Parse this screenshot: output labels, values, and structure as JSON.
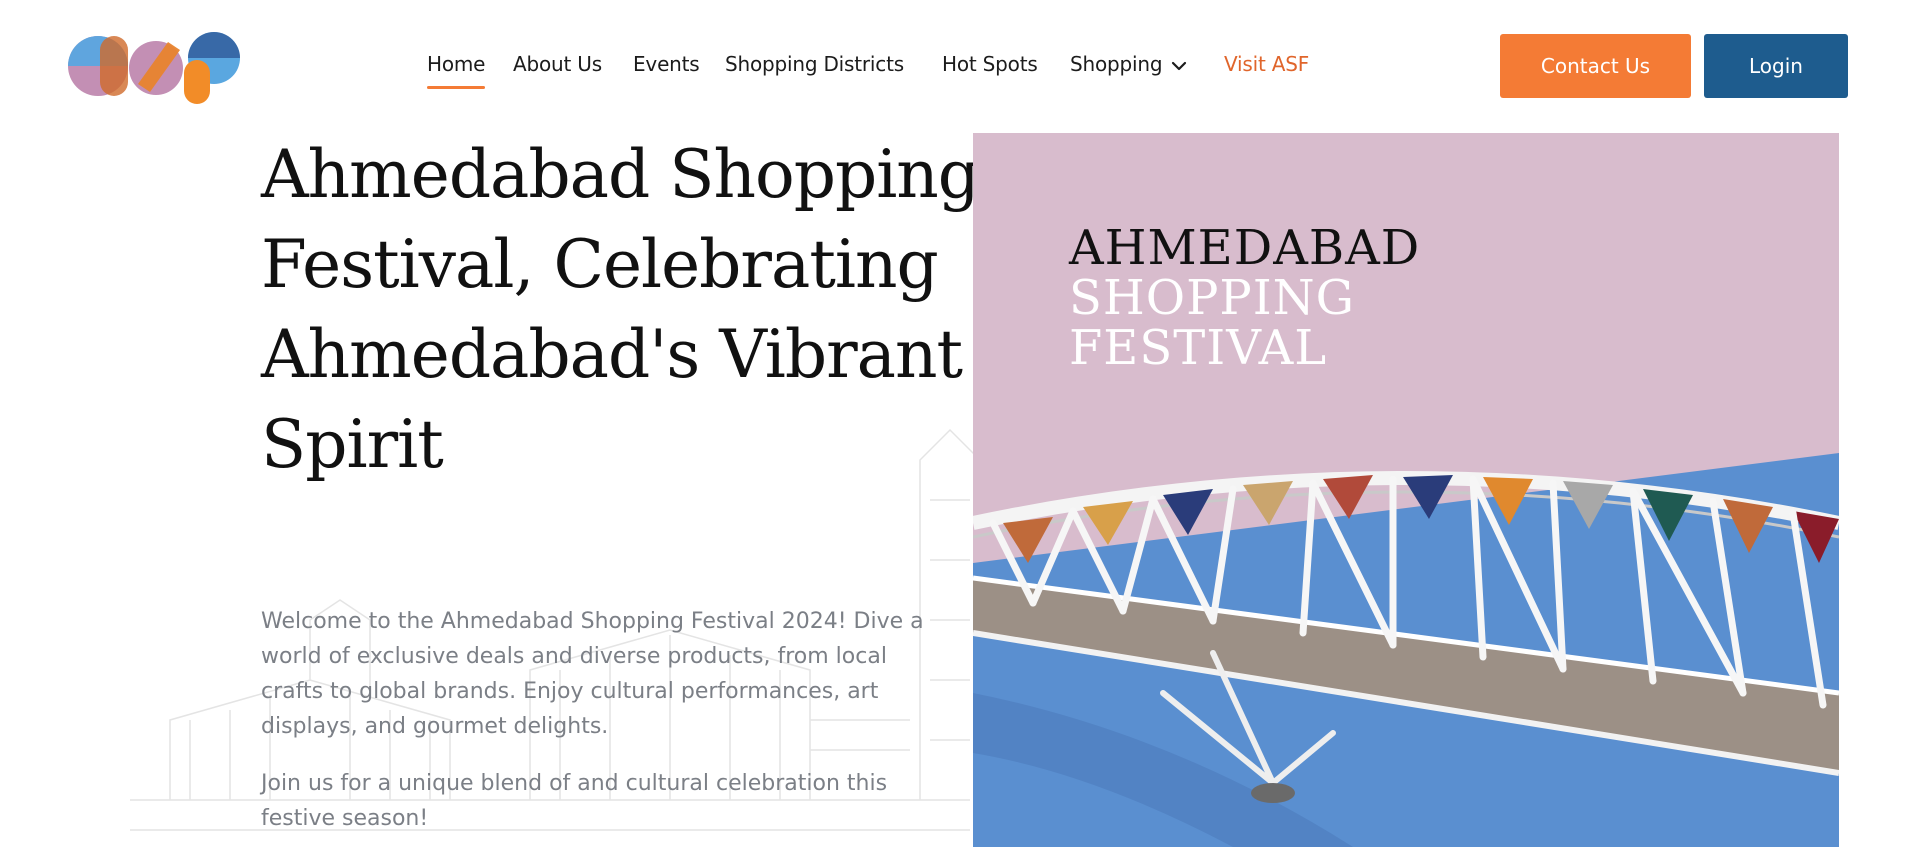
{
  "header": {
    "logo_alt": "asf",
    "nav": [
      {
        "label": "Home",
        "active": true
      },
      {
        "label": "About Us"
      },
      {
        "label": "Events"
      },
      {
        "label": "Shopping Districts"
      },
      {
        "label": "Hot Spots"
      },
      {
        "label": "Shopping",
        "has_dropdown": true
      },
      {
        "label": "Visit ASF"
      }
    ],
    "contact_label": "Contact Us",
    "login_label": "Login"
  },
  "hero": {
    "title": "Ahmedabad Shopping Festival, Celebrating Ahmedabad's Vibrant Spirit",
    "intro": "Welcome to the Ahmedabad Shopping Festival 2024! Dive a world of exclusive deals and diverse products, from local crafts to global brands. Enjoy cultural performances, art displays, and gourmet delights.",
    "invite": "Join us for a unique blend of and cultural celebration this festive season!",
    "image_text": {
      "line1": "AHMEDABAD",
      "line2": "SHOPPING",
      "line3": "FESTIVAL"
    }
  },
  "colors": {
    "accent_orange": "#f47b35",
    "login_blue": "#1e5c8e",
    "image_pink": "#d8bccd",
    "image_blue": "#5a8fd0"
  }
}
